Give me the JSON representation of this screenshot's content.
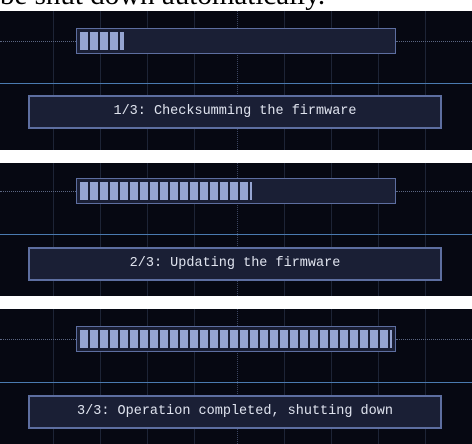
{
  "caption": "be shut down automatically.",
  "stages": [
    {
      "message": "1/3: Checksumming the firmware",
      "progress": 0.14
    },
    {
      "message": "2/3: Updating the firmware",
      "progress": 0.55
    },
    {
      "message": "3/3: Operation completed, shutting down",
      "progress": 1.0
    }
  ],
  "colors": {
    "screen_background": "#060812",
    "panel_background": "#1a1f35",
    "panel_border": "#5d6ea0",
    "progress_segment": "#96a5d2",
    "separator_line": "#4a7ab0",
    "message_text": "#dfe3ee"
  }
}
